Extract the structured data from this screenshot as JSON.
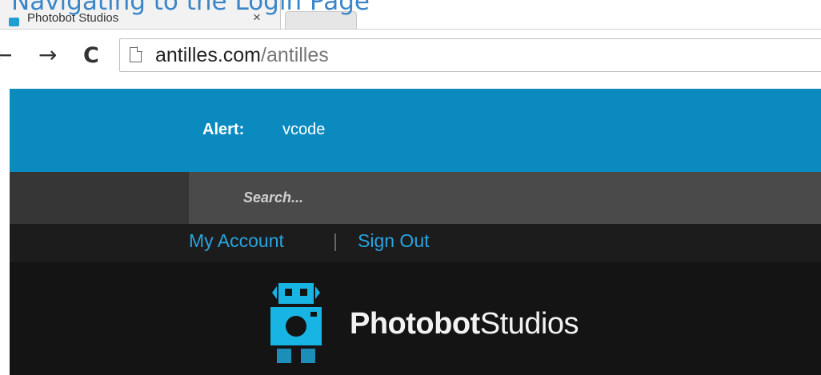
{
  "slide_heading": "Navigating to the Login Page",
  "browser": {
    "tab_title": "Photobot Studios",
    "tab_close": "×",
    "url_domain": "antilles.com",
    "url_path": "/antilles",
    "back_glyph": "←",
    "forward_glyph": "→",
    "reload_glyph": "C"
  },
  "alert": {
    "label": "Alert:",
    "text": "vcode"
  },
  "search": {
    "placeholder": "Search..."
  },
  "account": {
    "my_account": "My Account",
    "separator": "|",
    "sign_out": "Sign Out"
  },
  "brand": {
    "bold": "Photobot",
    "light": "Studios",
    "accent_color": "#18b4e3"
  },
  "colors": {
    "alert_bar": "#0b8abf",
    "link": "#29a4df",
    "heading": "#3a86c8"
  }
}
